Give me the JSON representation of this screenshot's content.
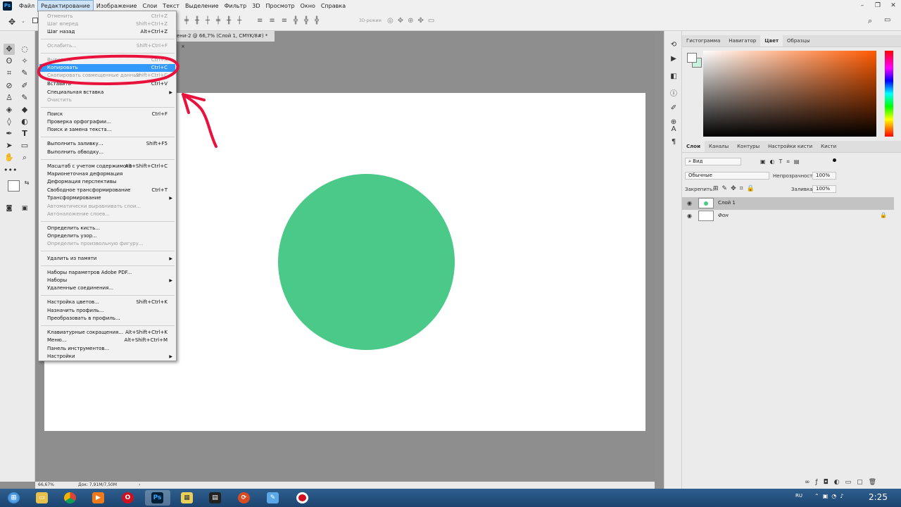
{
  "app": {
    "logo": "Ps",
    "menu": [
      "Файл",
      "Редактирование",
      "Изображение",
      "Слои",
      "Текст",
      "Выделение",
      "Фильтр",
      "3D",
      "Просмотр",
      "Окно",
      "Справка"
    ],
    "active_menu": "Редактирование"
  },
  "options_bar": {
    "mode_3d": "3D-режим"
  },
  "document": {
    "tab_title": "ени-2 @ 66,7% (Слой 1, CMYK/8#) *",
    "tab_close": "×",
    "circle_color": "#4bc988",
    "canvas_color": "#ffffff"
  },
  "status": {
    "zoom": "66,67%",
    "doc": "Док: 7,91M/7,50M",
    "arrow": "›"
  },
  "edit_menu": {
    "items": [
      {
        "label": "Отменить",
        "shortcut": "Ctrl+Z",
        "disabled": true
      },
      {
        "label": "Шаг вперед",
        "shortcut": "Shift+Ctrl+Z",
        "disabled": true
      },
      {
        "label": "Шаг назад",
        "shortcut": "Alt+Ctrl+Z",
        "disabled": false
      },
      {
        "label": "Ослабить...",
        "shortcut": "Shift+Ctrl+F",
        "disabled": true
      },
      {
        "label": "Вырезать",
        "shortcut": "Ctrl+X",
        "disabled": true
      },
      {
        "label": "Копировать",
        "shortcut": "Ctrl+C",
        "disabled": false,
        "highlighted": true
      },
      {
        "label": "Скопировать совмещенные данные",
        "shortcut": "Shift+Ctrl+C",
        "disabled": true
      },
      {
        "label": "Вставить",
        "shortcut": "Ctrl+V",
        "disabled": false
      },
      {
        "label": "Специальная вставка",
        "submenu": true,
        "disabled": false
      },
      {
        "label": "Очистить",
        "disabled": true
      },
      {
        "label": "Поиск",
        "shortcut": "Ctrl+F",
        "disabled": false
      },
      {
        "label": "Проверка орфографии...",
        "disabled": false
      },
      {
        "label": "Поиск и замена текста...",
        "disabled": false
      },
      {
        "label": "Выполнить заливку...",
        "shortcut": "Shift+F5",
        "disabled": false
      },
      {
        "label": "Выполнить обводку...",
        "disabled": false
      },
      {
        "label": "Масштаб с учетом содержимого",
        "shortcut": "Alt+Shift+Ctrl+C",
        "disabled": false
      },
      {
        "label": "Марионеточная деформация",
        "disabled": false
      },
      {
        "label": "Деформация перспективы",
        "disabled": false
      },
      {
        "label": "Свободное трансформирование",
        "shortcut": "Ctrl+T",
        "disabled": false
      },
      {
        "label": "Трансформирование",
        "submenu": true,
        "disabled": false
      },
      {
        "label": "Автоматически выравнивать слои...",
        "disabled": true
      },
      {
        "label": "Автоналожение слоев...",
        "disabled": true
      },
      {
        "label": "Определить кисть...",
        "disabled": false
      },
      {
        "label": "Определить узор...",
        "disabled": false
      },
      {
        "label": "Определить произвольную фигуру...",
        "disabled": true
      },
      {
        "label": "Удалить из памяти",
        "submenu": true,
        "disabled": false
      },
      {
        "label": "Наборы параметров Adobe PDF...",
        "disabled": false
      },
      {
        "label": "Наборы",
        "submenu": true,
        "disabled": false
      },
      {
        "label": "Удаленные соединения...",
        "disabled": false
      },
      {
        "label": "Настройка цветов...",
        "shortcut": "Shift+Ctrl+K",
        "disabled": false
      },
      {
        "label": "Назначить профиль...",
        "disabled": false
      },
      {
        "label": "Преобразовать в профиль...",
        "disabled": false
      },
      {
        "label": "Клавиатурные сокращения...",
        "shortcut": "Alt+Shift+Ctrl+K",
        "disabled": false
      },
      {
        "label": "Меню...",
        "shortcut": "Alt+Shift+Ctrl+M",
        "disabled": false
      },
      {
        "label": "Панель инструментов...",
        "disabled": false
      },
      {
        "label": "Настройки",
        "submenu": true,
        "disabled": false
      }
    ]
  },
  "color_panel": {
    "tabs": [
      "Гистограмма",
      "Навигатор",
      "Цвет",
      "Образцы"
    ],
    "active_tab": "Цвет",
    "foreground": "#ffffff",
    "background": "#c9f1dd",
    "hue_color": "#ff5a00"
  },
  "layers_panel": {
    "tabs": [
      "Слои",
      "Каналы",
      "Контуры",
      "Настройки кисти",
      "Кисти"
    ],
    "active_tab": "Слои",
    "filter": "Вид",
    "blend_mode": "Обычные",
    "opacity_label": "Непрозрачность:",
    "opacity": "100%",
    "lock_label": "Закрепить:",
    "fill_label": "Заливка:",
    "fill": "100%",
    "layers": [
      {
        "name": "Слой 1",
        "selected": true
      },
      {
        "name": "Фон",
        "selected": false,
        "locked": true
      }
    ]
  },
  "taskbar": {
    "lang": "RU",
    "time": "2:25"
  }
}
